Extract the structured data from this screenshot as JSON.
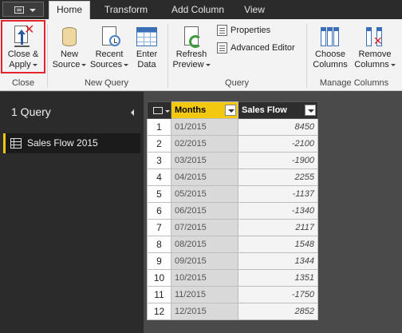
{
  "tabs": [
    {
      "label": "Home",
      "active": true
    },
    {
      "label": "Transform",
      "active": false
    },
    {
      "label": "Add Column",
      "active": false
    },
    {
      "label": "View",
      "active": false
    }
  ],
  "ribbon": {
    "close_group": {
      "label": "Close",
      "btn_line1": "Close &",
      "btn_line2": "Apply"
    },
    "new_query_group": {
      "label": "New Query",
      "new_source": [
        "New",
        "Source"
      ],
      "recent_sources": [
        "Recent",
        "Sources"
      ],
      "enter_data": [
        "Enter",
        "Data"
      ]
    },
    "query_group": {
      "label": "Query",
      "refresh_preview": [
        "Refresh",
        "Preview"
      ],
      "properties": "Properties",
      "advanced_editor": "Advanced Editor"
    },
    "manage_columns_group": {
      "label": "Manage Columns",
      "choose_columns": [
        "Choose",
        "Columns"
      ],
      "remove_columns": [
        "Remove",
        "Columns"
      ]
    }
  },
  "queries_panel": {
    "title": "1 Query",
    "items": [
      {
        "label": "Sales Flow 2015",
        "selected": true
      }
    ]
  },
  "grid": {
    "columns": [
      "Months",
      "Sales Flow"
    ],
    "rows": [
      {
        "n": "1",
        "month": "01/2015",
        "value": "8450"
      },
      {
        "n": "2",
        "month": "02/2015",
        "value": "-2100"
      },
      {
        "n": "3",
        "month": "03/2015",
        "value": "-1900"
      },
      {
        "n": "4",
        "month": "04/2015",
        "value": "2255"
      },
      {
        "n": "5",
        "month": "05/2015",
        "value": "-1137"
      },
      {
        "n": "6",
        "month": "06/2015",
        "value": "-1340"
      },
      {
        "n": "7",
        "month": "07/2015",
        "value": "2117"
      },
      {
        "n": "8",
        "month": "08/2015",
        "value": "1548"
      },
      {
        "n": "9",
        "month": "09/2015",
        "value": "1344"
      },
      {
        "n": "10",
        "month": "10/2015",
        "value": "1351"
      },
      {
        "n": "11",
        "month": "11/2015",
        "value": "-1750"
      },
      {
        "n": "12",
        "month": "12/2015",
        "value": "2852"
      }
    ]
  },
  "colors": {
    "accent": "#f2c811",
    "highlight_box": "#e3242b",
    "ribbon_bg": "#f3f3f3",
    "panel_bg": "#2b2b2b"
  }
}
